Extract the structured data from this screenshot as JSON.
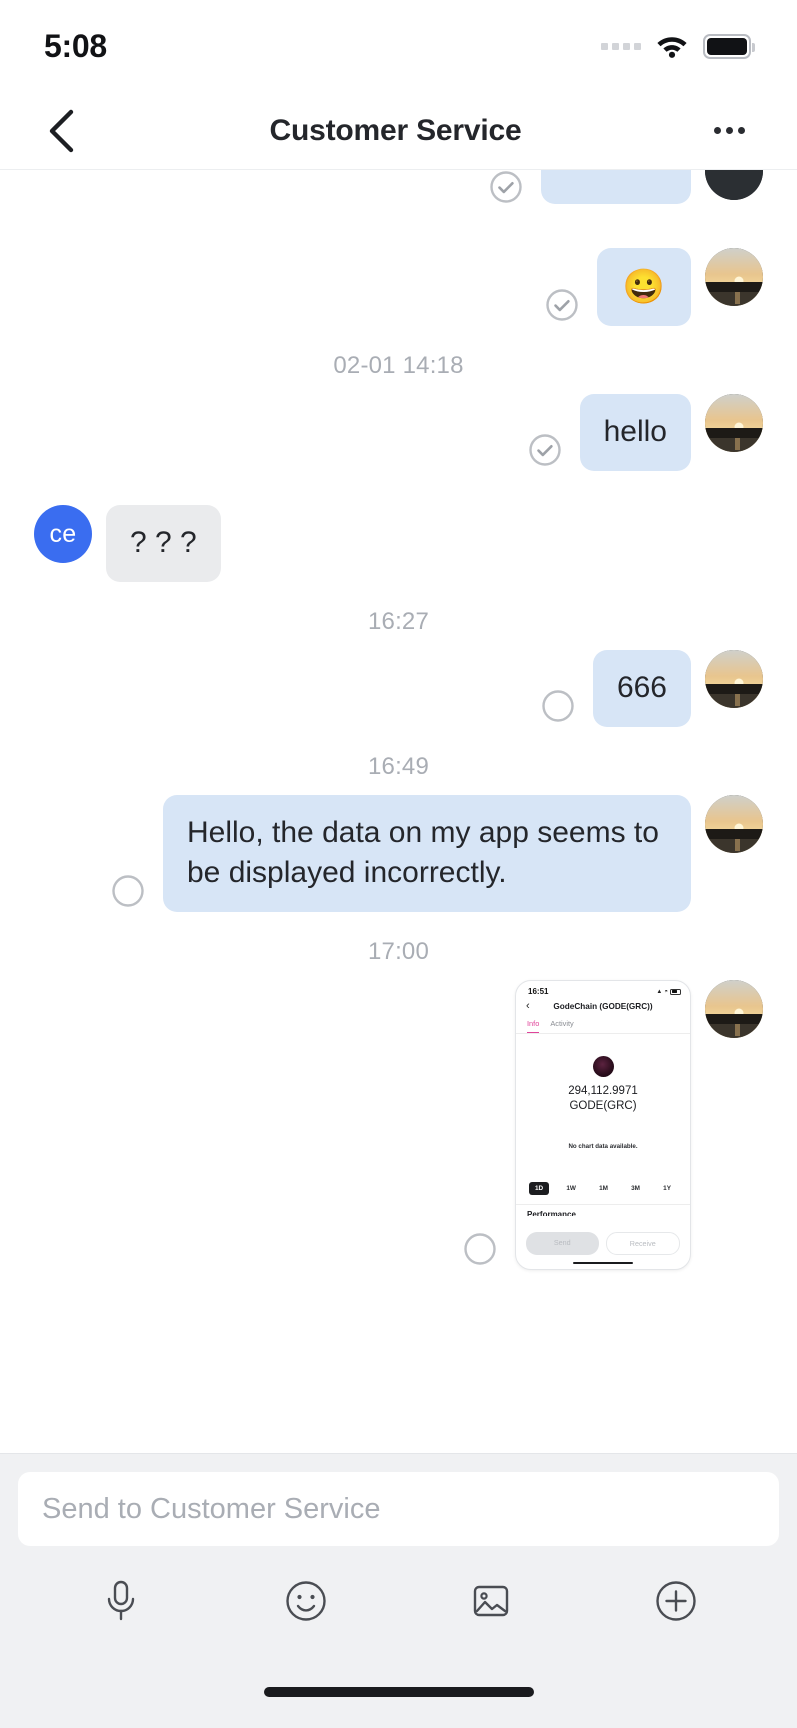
{
  "status_bar": {
    "time": "5:08",
    "signal_icon": "signal-dots-icon",
    "wifi_icon": "wifi-icon",
    "battery_icon": "battery-full-icon"
  },
  "header": {
    "back_icon": "chevron-left-icon",
    "title": "Customer Service",
    "more_icon": "more-horizontal-icon"
  },
  "conversation": {
    "messages": [
      {
        "id": "msg-0",
        "side": "out",
        "type": "clipped",
        "text": "",
        "status": "sent",
        "avatar": "sunset-photo-avatar"
      },
      {
        "id": "msg-1",
        "side": "out",
        "type": "emoji",
        "text": "😀",
        "status": "sent",
        "avatar": "sunset-photo-avatar"
      },
      {
        "id": "ts-1",
        "type": "timestamp",
        "text": "02-01 14:18"
      },
      {
        "id": "msg-2",
        "side": "out",
        "type": "text",
        "text": "hello",
        "status": "sent",
        "avatar": "sunset-photo-avatar"
      },
      {
        "id": "msg-3",
        "side": "in",
        "type": "text",
        "text": "? ? ?",
        "avatar_initials": "ce"
      },
      {
        "id": "ts-2",
        "type": "timestamp",
        "text": "16:27"
      },
      {
        "id": "msg-4",
        "side": "out",
        "type": "text",
        "text": "666",
        "status": "pending",
        "avatar": "sunset-photo-avatar"
      },
      {
        "id": "ts-3",
        "type": "timestamp",
        "text": "16:49"
      },
      {
        "id": "msg-5",
        "side": "out",
        "type": "text",
        "text": "Hello, the data on my app seems to be displayed incorrectly.",
        "status": "pending",
        "avatar": "sunset-photo-avatar"
      },
      {
        "id": "ts-4",
        "type": "timestamp",
        "text": "17:00"
      },
      {
        "id": "msg-6",
        "side": "out",
        "type": "image",
        "status": "pending",
        "avatar": "sunset-photo-avatar"
      }
    ]
  },
  "attached_screenshot": {
    "status_time": "16:51",
    "back_icon": "chevron-left-icon",
    "title": "GodeChain (GODE(GRC))",
    "tabs": [
      {
        "label": "Info",
        "active": true
      },
      {
        "label": "Activity",
        "active": false
      }
    ],
    "token_icon": "gode-token-icon",
    "balance_amount": "294,112.9971",
    "balance_symbol": "GODE(GRC)",
    "chart_message": "No chart data available.",
    "ranges": [
      {
        "label": "1D",
        "active": true
      },
      {
        "label": "1W",
        "active": false
      },
      {
        "label": "1M",
        "active": false
      },
      {
        "label": "3M",
        "active": false
      },
      {
        "label": "1Y",
        "active": false
      }
    ],
    "section_label": "Performance",
    "send_label": "Send",
    "receive_label": "Receive"
  },
  "composer": {
    "placeholder": "Send to Customer Service",
    "tools": [
      {
        "name": "microphone-icon",
        "label": "Voice"
      },
      {
        "name": "emoji-icon",
        "label": "Emoji"
      },
      {
        "name": "image-icon",
        "label": "Photo"
      },
      {
        "name": "plus-circle-icon",
        "label": "More"
      }
    ]
  },
  "colors": {
    "bubble_out": "#d7e5f6",
    "bubble_in": "#eaebed",
    "accent_avatar": "#3a6df0",
    "accent_tab": "#e0449a",
    "composer_bg": "#f0f1f3"
  }
}
